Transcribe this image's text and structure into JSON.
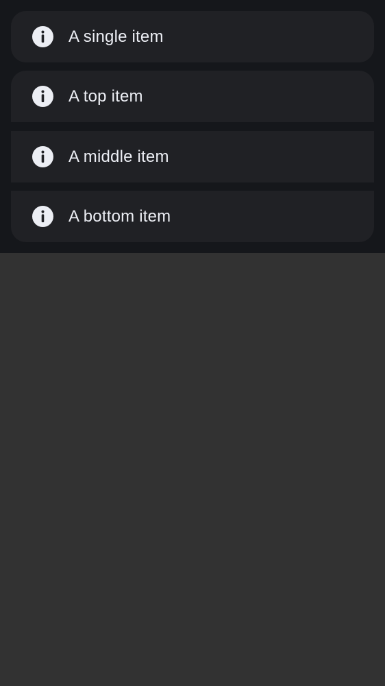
{
  "list": {
    "items": [
      {
        "label": "A single item",
        "icon": "info-icon"
      },
      {
        "label": "A top item",
        "icon": "info-icon"
      },
      {
        "label": "A middle item",
        "icon": "info-icon"
      },
      {
        "label": "A bottom item",
        "icon": "info-icon"
      }
    ]
  },
  "colors": {
    "panel_background": "#15171b",
    "item_background": "#202125",
    "page_background": "#323232",
    "text": "#eceef4"
  }
}
